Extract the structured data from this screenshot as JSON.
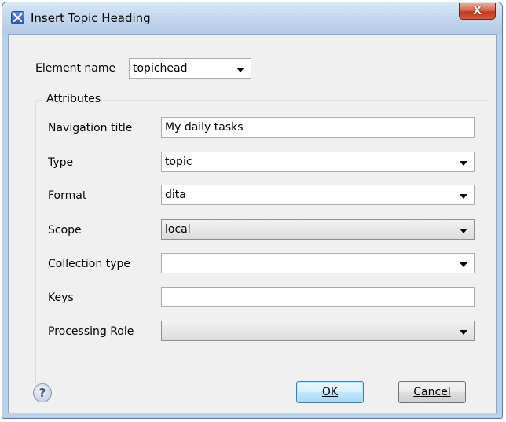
{
  "window": {
    "title": "Insert Topic Heading",
    "close_glyph": "X"
  },
  "element_name": {
    "label": "Element name",
    "value": "topichead"
  },
  "attributes": {
    "group_title": "Attributes",
    "fields": [
      {
        "label": "Navigation title",
        "value": "My daily tasks",
        "kind": "text"
      },
      {
        "label": "Type",
        "value": "topic",
        "kind": "combo"
      },
      {
        "label": "Format",
        "value": "dita",
        "kind": "combo"
      },
      {
        "label": "Scope",
        "value": "local",
        "kind": "combo-gray"
      },
      {
        "label": "Collection type",
        "value": "",
        "kind": "combo"
      },
      {
        "label": "Keys",
        "value": "",
        "kind": "text"
      },
      {
        "label": "Processing Role",
        "value": "",
        "kind": "combo-gray"
      }
    ]
  },
  "buttons": {
    "ok": "OK",
    "cancel": "Cancel"
  },
  "icons": {
    "app": "oxygen-app-icon",
    "help": "help-icon",
    "help_glyph": "?"
  },
  "colors": {
    "titlebar": "#c3d7ed",
    "client_bg": "#f0f0f0",
    "close_button": "#c0391f",
    "default_button": "#bee6fd"
  }
}
